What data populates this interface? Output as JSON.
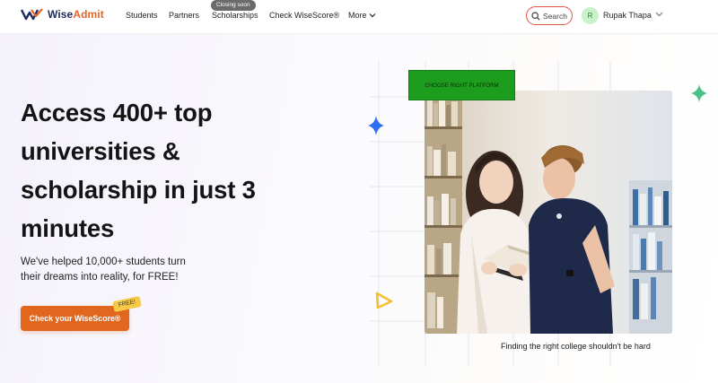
{
  "header": {
    "logo_name_primary": "Wise",
    "logo_name_accent": "Admit",
    "nav": [
      {
        "label": "Students"
      },
      {
        "label": "Partners"
      },
      {
        "label": "Scholarships",
        "badge": "Closing soon"
      },
      {
        "label": "Check WiseScore®"
      },
      {
        "label": "More"
      }
    ],
    "search_label": "Search",
    "user_initial": "R",
    "user_name": "Rupak Thapa"
  },
  "hero": {
    "headline_line1": "Access 400+ top",
    "headline_line2": "universities &",
    "headline_line3": "scholarship in just 3",
    "headline_line4": "minutes",
    "subtext_line1": "We've helped 10,000+ students turn",
    "subtext_line2": "their dreams into reality, for FREE!",
    "cta_label": "Check your WiseScore®",
    "cta_tag": "FREE!",
    "platform_button": "CHOOSE RIGHT PLATFORM",
    "caption": "Finding the right college shouldn't be hard"
  },
  "colors": {
    "brand_navy": "#1c2a5e",
    "brand_orange": "#e2671e",
    "search_border": "#e05545",
    "platform_green": "#1d9d1d"
  },
  "icons": [
    "logo-icon",
    "search-icon",
    "chevron-down-icon",
    "sparkle-icon",
    "triangle-icon"
  ]
}
